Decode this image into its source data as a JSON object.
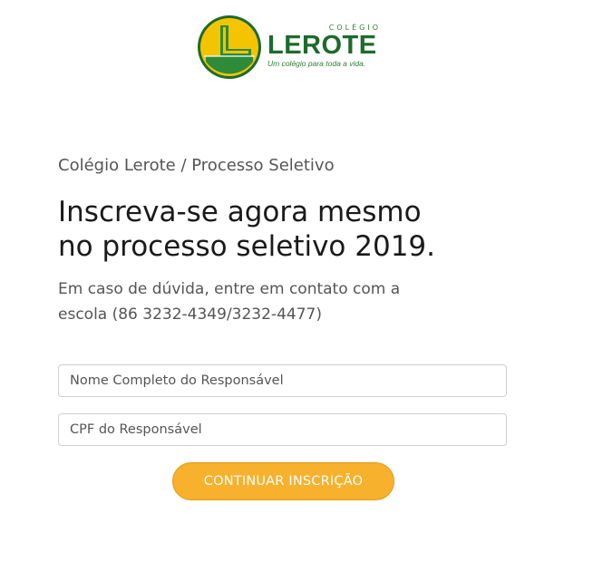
{
  "logo": {
    "school_label": "COLÉGIO",
    "name": "LEROTE",
    "tagline": "Um colégio para toda a vida."
  },
  "breadcrumb": "Colégio Lerote / Processo Seletivo",
  "headline": {
    "line1": "Inscreva-se agora mesmo",
    "line2": "no processo seletivo 2019."
  },
  "subtitle": {
    "line1": "Em caso de dúvida, entre em contato com a",
    "line2": "escola (86 3232-4349/3232-4477)"
  },
  "form": {
    "name_placeholder": "Nome Completo do Responsável",
    "cpf_placeholder": "CPF do Responsável",
    "submit_label": "CONTINUAR INSCRIÇÃO"
  },
  "colors": {
    "brand_green": "#1d6b2b",
    "brand_yellow": "#f5c400",
    "button": "#f8b12c"
  },
  "icons": {
    "logo_mark": "lerote-logo-icon"
  }
}
